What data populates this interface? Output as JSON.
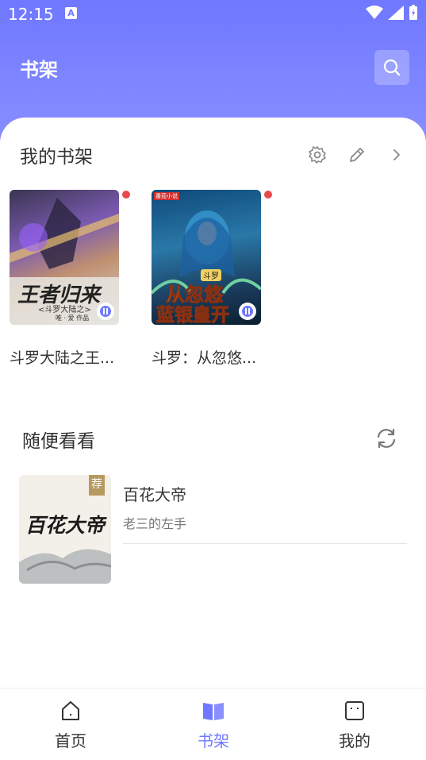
{
  "status_bar": {
    "time": "12:15",
    "badge": "A"
  },
  "header": {
    "title": "书架"
  },
  "shelf": {
    "title": "我的书架",
    "books": [
      {
        "title": "斗罗大陆之王...",
        "cover_text": "王者归来",
        "cover_sub": "<斗罗大陆之>",
        "cover_author": "唯 · 爱 作品"
      },
      {
        "title": "斗罗：从忽悠...",
        "cover_text": "从忽悠",
        "cover_text2": "蓝银皇开",
        "cover_tag": "斗罗",
        "cover_brand": "番茄小说"
      }
    ]
  },
  "browse": {
    "title": "随便看看",
    "item": {
      "title": "百花大帝",
      "author": "老三的左手",
      "tag": "荐",
      "cover_text": "百花大帝"
    }
  },
  "nav": {
    "items": [
      {
        "label": "首页"
      },
      {
        "label": "书架"
      },
      {
        "label": "我的"
      }
    ],
    "active_color": "#6f78ff",
    "inactive_color": "#333333"
  }
}
